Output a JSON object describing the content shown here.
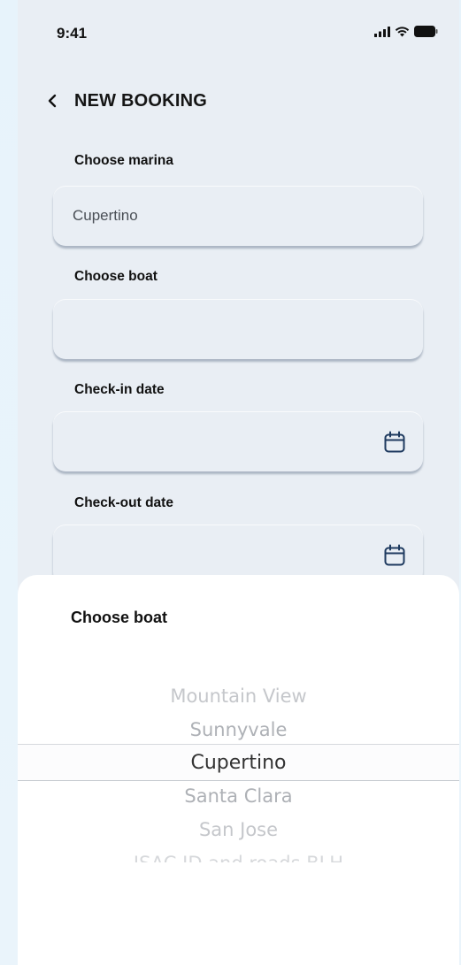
{
  "status_bar": {
    "time": "9:41",
    "icons": [
      "signal-icon",
      "wifi-icon",
      "battery-icon"
    ]
  },
  "header": {
    "title": "NEW BOOKING",
    "back_icon": "chevron-left-icon"
  },
  "form": {
    "marina": {
      "label": "Choose marina",
      "value": "Cupertino"
    },
    "boat": {
      "label": "Choose boat",
      "value": ""
    },
    "checkin": {
      "label": "Check-in date",
      "value": "",
      "icon": "calendar-icon"
    },
    "checkout": {
      "label": "Check-out date",
      "value": "",
      "icon": "calendar-icon"
    }
  },
  "sheet": {
    "title": "Choose boat",
    "options": [
      {
        "label": "Mountain View"
      },
      {
        "label": "Sunnyvale"
      },
      {
        "label": "Cupertino"
      },
      {
        "label": "Santa Clara"
      },
      {
        "label": "San Jose"
      },
      {
        "label": "ISAC ID and roads BLH"
      }
    ],
    "selected": "Cupertino"
  },
  "colors": {
    "background": "#e9eef4",
    "sheet": "#ffffff",
    "accent_icon": "#1e3a5f"
  }
}
